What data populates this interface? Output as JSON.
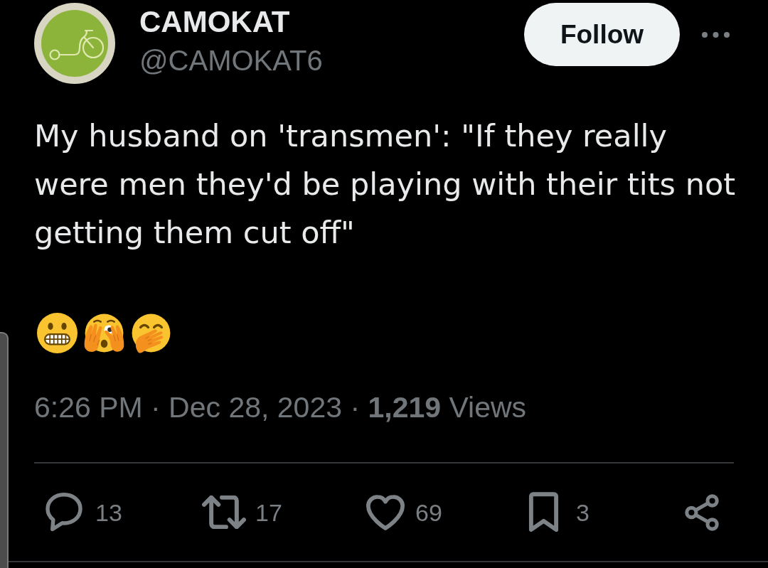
{
  "author": {
    "name": "CAMOKAT",
    "handle": "@CAMOKAT6"
  },
  "follow_button": {
    "label": "Follow"
  },
  "tweet": {
    "text": "My husband on 'transmen': \"If they really were men they'd be playing with their tits not getting them cut off\"",
    "emojis": [
      {
        "kind": "grimacing"
      },
      {
        "kind": "peeking_eye"
      },
      {
        "kind": "hand_over_mouth"
      }
    ],
    "meta": "6:26 PM · Dec 28, 2023 · **1,219** Views"
  },
  "actions": [
    {
      "kind": "reply",
      "count": "13"
    },
    {
      "kind": "repost",
      "count": "17"
    },
    {
      "kind": "like",
      "count": "69"
    },
    {
      "kind": "bookmark",
      "count": "3"
    },
    {
      "kind": "share"
    }
  ]
}
